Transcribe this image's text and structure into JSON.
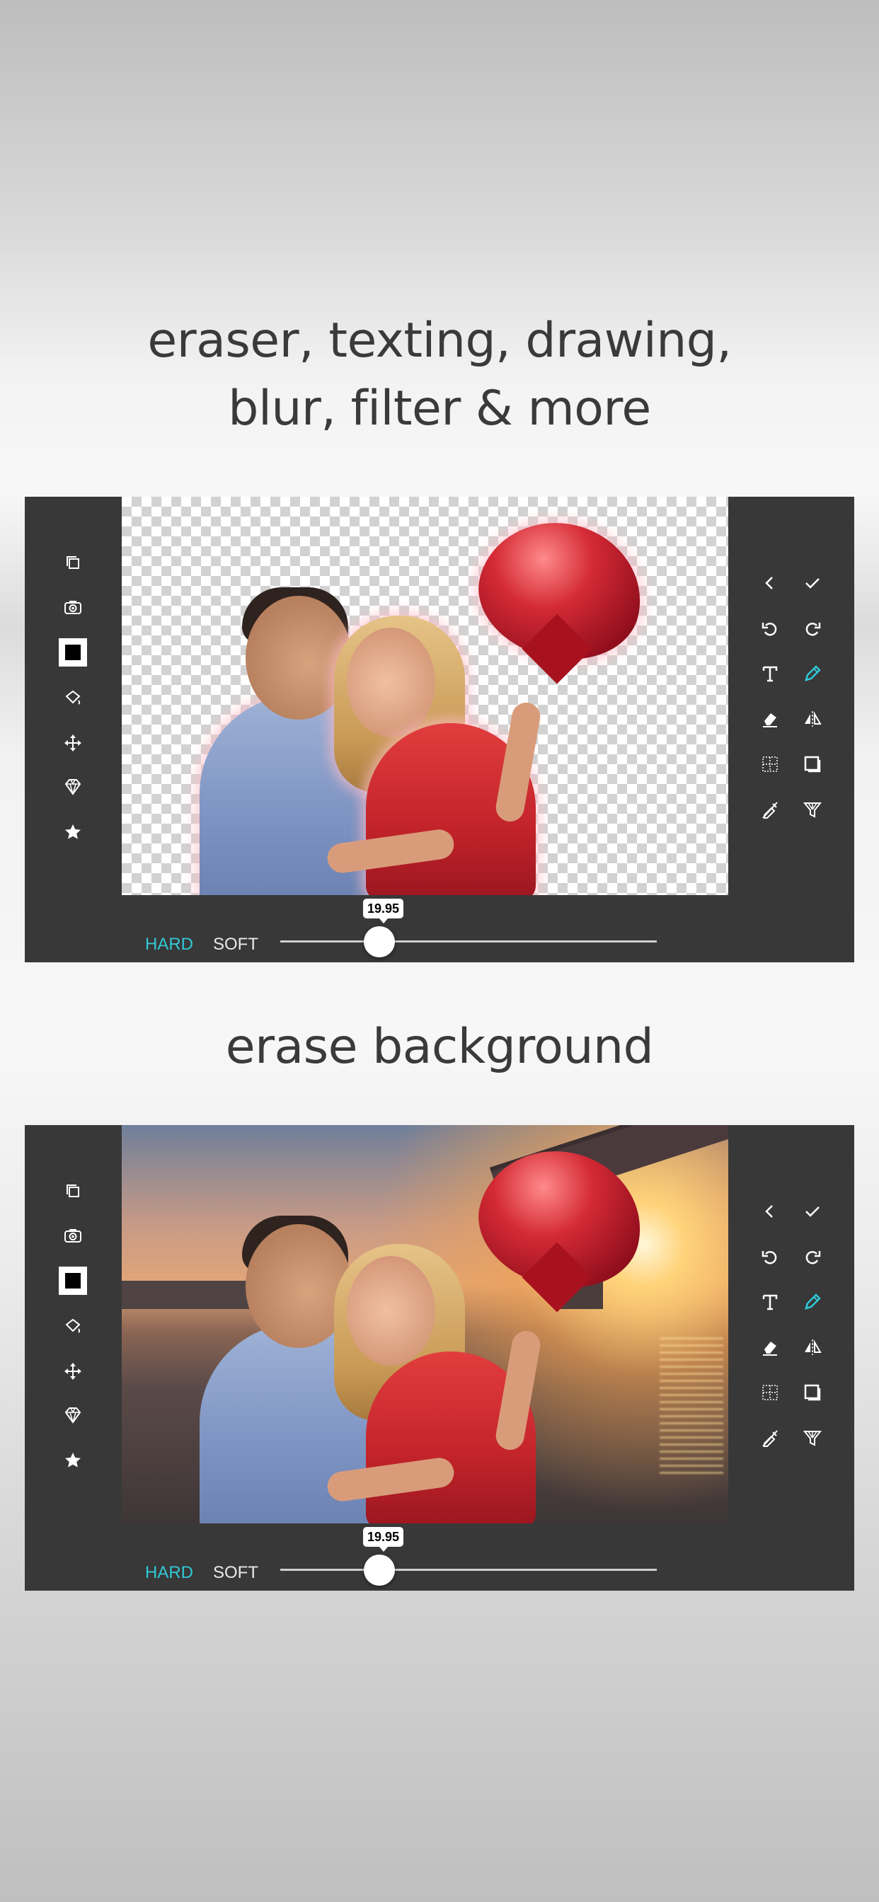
{
  "headline_top": {
    "line1": "eraser, texting, drawing,",
    "line2": "blur, filter & more"
  },
  "headline_middle": "erase background",
  "accent_color": "#30c9d6",
  "panels": [
    {
      "variant": "transparent-checkerboard",
      "slider": {
        "hard_label": "HARD",
        "soft_label": "SOFT",
        "value": "19.95",
        "active_mode": "HARD"
      }
    },
    {
      "variant": "full-photo",
      "slider": {
        "hard_label": "HARD",
        "soft_label": "SOFT",
        "value": "19.95",
        "active_mode": "HARD"
      }
    }
  ],
  "left_tools": [
    "layers-icon",
    "camera-icon",
    "color-square-icon",
    "paint-bucket-icon",
    "move-icon",
    "diamond-icon",
    "star-icon"
  ],
  "right_tools": [
    "back-icon",
    "check-icon",
    "undo-icon",
    "redo-icon",
    "text-icon",
    "pencil-icon",
    "eraser-icon",
    "flip-icon",
    "grid-icon",
    "square-icon",
    "dropper-icon",
    "filter-icon"
  ]
}
